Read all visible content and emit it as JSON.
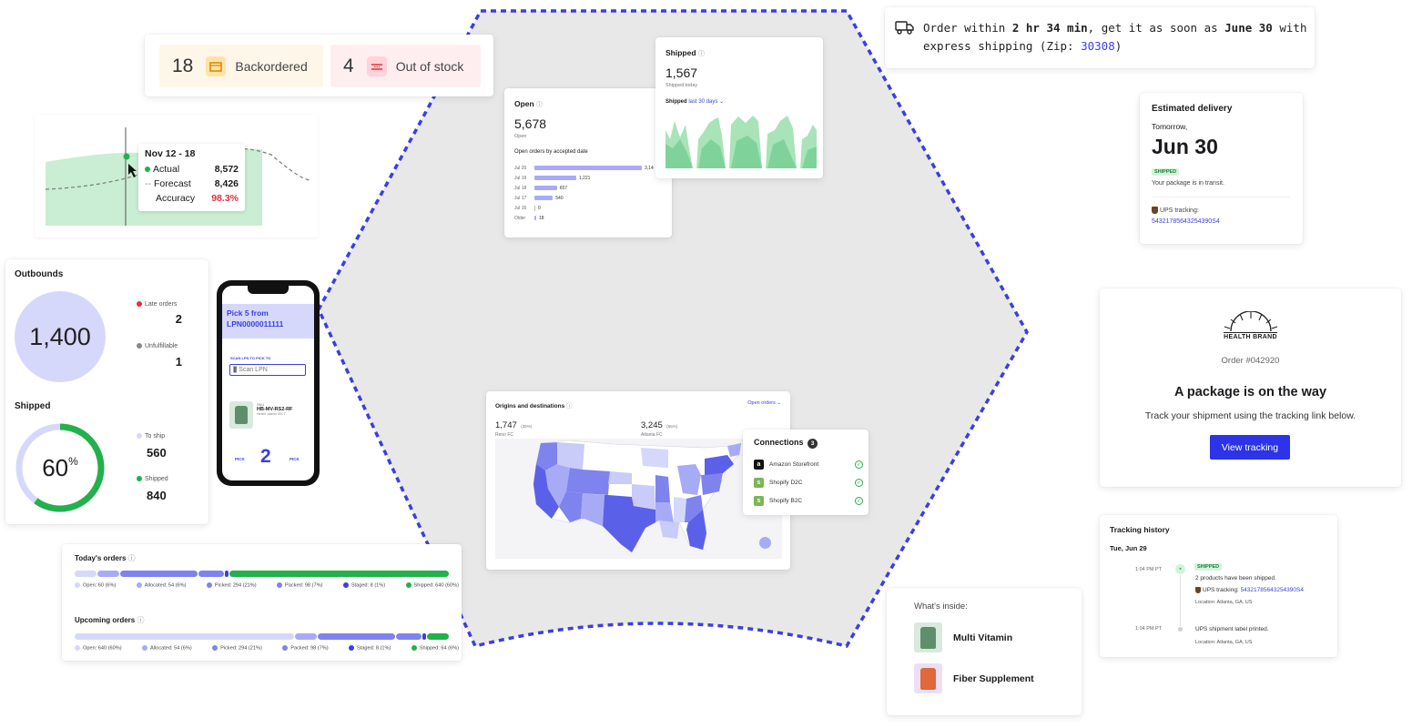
{
  "colors": {
    "accent": "#3b3fe0",
    "shipped_green": "#22b14c",
    "late_red": "#e5303b",
    "periwinkle": "#d6d8fb",
    "bar_blue": "#a7abf5",
    "mid_blue": "#7f83ee",
    "dark_blue": "#3b3fe0",
    "chart_green": "#a9e3b8",
    "hex_bg": "#e8e8e8"
  },
  "inventory": {
    "backordered_count": "18",
    "backordered_label": "Backordered",
    "backordered_icon": "box-icon",
    "out_count": "4",
    "out_label": "Out of stock",
    "out_icon": "empty-shelf-icon"
  },
  "forecast": {
    "date_range": "Nov 12 - 18",
    "actual_label": "Actual",
    "actual_value": "8,572",
    "forecast_label": "Forecast",
    "forecast_value": "8,426",
    "accuracy_label": "Accuracy",
    "accuracy_value": "98.3%"
  },
  "outbounds": {
    "title": "Outbounds",
    "total": "1,400",
    "late_label": "Late orders",
    "late_value": "2",
    "unfulfillable_label": "Unfulfillable",
    "unfulfillable_value": "1",
    "shipped_title": "Shipped",
    "shipped_pct": "60",
    "shipped_pct_unit": "%",
    "shipped_fraction": 0.6,
    "to_ship_label": "To ship",
    "to_ship_value": "560",
    "shipped_label": "Shipped",
    "shipped_value": "840"
  },
  "phone": {
    "pick_title": "Pick 5 from LPN0000011111",
    "scan_hint": "SCAN LPN TO PICK TO",
    "scan_placeholder": "Scan LPN",
    "sku_label": "SKU",
    "sku_value": "HB-MV-RS2-RF",
    "sku_desc": "Health vitamin 60CT",
    "pick_left": "PICK",
    "pick_count": "2",
    "pick_right": "PICK"
  },
  "today_orders": {
    "title": "Today's orders",
    "segments": [
      {
        "label": "Open: 60 (6%)",
        "fraction": 0.06
      },
      {
        "label": "Allocated: 54 (6%)",
        "fraction": 0.06
      },
      {
        "label": "Picked: 294 (21%)",
        "fraction": 0.21
      },
      {
        "label": "Packed: 98 (7%)",
        "fraction": 0.07
      },
      {
        "label": "Staged: 8 (1%)",
        "fraction": 0.01
      },
      {
        "label": "Shipped: 640 (60%)",
        "fraction": 0.6
      }
    ]
  },
  "upcoming_orders": {
    "title": "Upcoming orders",
    "segments": [
      {
        "label": "Open: 640 (60%)",
        "fraction": 0.6
      },
      {
        "label": "Allocated: 54 (6%)",
        "fraction": 0.06
      },
      {
        "label": "Picked: 294 (21%)",
        "fraction": 0.21
      },
      {
        "label": "Packed: 98 (7%)",
        "fraction": 0.07
      },
      {
        "label": "Staged: 8 (1%)",
        "fraction": 0.01
      },
      {
        "label": "Shipped: 64 (6%)",
        "fraction": 0.06
      }
    ]
  },
  "open_card": {
    "title": "Open",
    "value": "5,678",
    "sub": "Open",
    "chart_title": "Open orders by accepted date",
    "rows": [
      {
        "date": "Jul 20",
        "value": "3,14",
        "num": 3140
      },
      {
        "date": "Jul 19",
        "value": "1,221",
        "num": 1221
      },
      {
        "date": "Jul 18",
        "value": "657",
        "num": 657
      },
      {
        "date": "Jul 17",
        "value": "540",
        "num": 540
      },
      {
        "date": "Jul 16",
        "value": "0",
        "num": 0
      },
      {
        "date": "Older",
        "value": "18",
        "num": 18
      }
    ]
  },
  "shipped_card": {
    "title": "Shipped",
    "value": "1,567",
    "sub": "Shipped today",
    "filter_label": "Shipped",
    "filter_value": "last 30 days"
  },
  "delivery_banner": {
    "text1": "Order within ",
    "time": "2 hr 34 min",
    "text2": ", get it as soon as ",
    "date": "June 30",
    "text3": " with",
    "text4": "express shipping (Zip: ",
    "zip": "30308",
    "text5": ")"
  },
  "estimated": {
    "title": "Estimated delivery",
    "day": "Tomorrow,",
    "date": "Jun 30",
    "badge": "SHIPPED",
    "status": "Your package is in transit.",
    "tracking_label": "UPS tracking:",
    "tracking_number": "54321785643254390S4"
  },
  "email": {
    "brand": "HEALTH BRAND",
    "order": "Order #042920",
    "headline": "A package is on the way",
    "body": "Track your shipment using the tracking link below.",
    "button": "View tracking"
  },
  "origins": {
    "title": "Origins and destinations",
    "dropdown": "Open orders",
    "reno_value": "1,747",
    "reno_pct": "(35%)",
    "reno_label": "Reno FC",
    "atl_value": "3,245",
    "atl_pct": "(65%)",
    "atl_label": "Atlanta FC"
  },
  "connections": {
    "title": "Connections",
    "count": "3",
    "items": [
      {
        "name": "Amazon Storefront",
        "icon": "amazon-icon"
      },
      {
        "name": "Shopify D2C",
        "icon": "shopify-icon"
      },
      {
        "name": "Shopify B2C",
        "icon": "shopify-icon"
      }
    ]
  },
  "tracking_history": {
    "title": "Tracking history",
    "day": "Tue, Jun 29",
    "e1_time": "1:04 PM PT",
    "e1_badge": "SHIPPED",
    "e1_text": "2 products have been shipped.",
    "e1_tracking_label": "UPS tracking:",
    "e1_tracking": "54321785643254390S4",
    "e1_location": "Location: Atlanta, GA, US",
    "e2_time": "1:04 PM PT",
    "e2_text": "UPS shipment label printed.",
    "e2_location": "Location: Atlanta, GA, US"
  },
  "whats_inside": {
    "title": "What's inside:",
    "items": [
      {
        "name": "Multi Vitamin"
      },
      {
        "name": "Fiber Supplement"
      }
    ]
  }
}
